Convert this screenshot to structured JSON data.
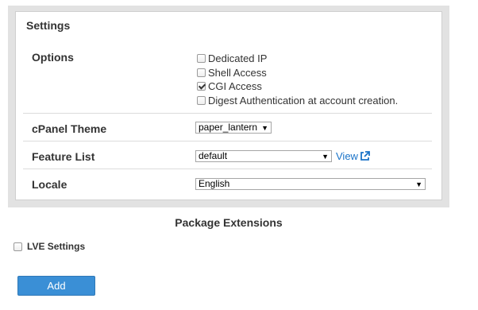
{
  "settings": {
    "title": "Settings",
    "options": {
      "label": "Options",
      "items": [
        {
          "label": "Dedicated IP",
          "checked": false
        },
        {
          "label": "Shell Access",
          "checked": false
        },
        {
          "label": "CGI Access",
          "checked": true
        },
        {
          "label": "Digest Authentication at account creation.",
          "checked": false
        }
      ]
    },
    "cpanel_theme": {
      "label": "cPanel Theme",
      "value": "paper_lantern"
    },
    "feature_list": {
      "label": "Feature List",
      "value": "default",
      "view_link": "View"
    },
    "locale": {
      "label": "Locale",
      "value": "English"
    }
  },
  "package_extensions": {
    "heading": "Package Extensions",
    "lve_settings": {
      "label": "LVE Settings",
      "checked": false
    }
  },
  "add_button": {
    "label": "Add"
  },
  "colors": {
    "accent": "#3a8fd6",
    "link": "#1a73c8",
    "panel_border": "#e2e2e2"
  }
}
